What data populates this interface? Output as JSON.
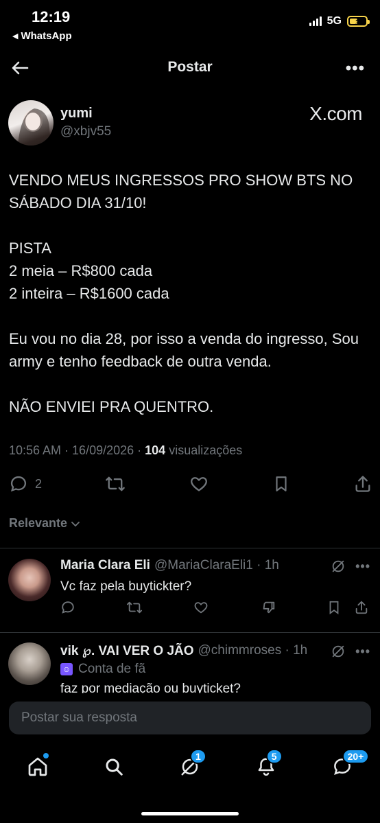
{
  "status": {
    "time": "12:19",
    "back_app": "WhatsApp",
    "network": "5G"
  },
  "header": {
    "title": "Postar"
  },
  "post": {
    "author_name": "yumi",
    "author_handle": "@xbjv55",
    "watermark": "X.com",
    "lines": [
      "VENDO MEUS INGRESSOS PRO SHOW BTS NO SÁBADO DIA 31/10!",
      "",
      "PISTA",
      "2 meia – R$800 cada",
      "2 inteira – R$1600 cada",
      "",
      "Eu vou no dia 28, por isso a venda do ingresso, Sou army e tenho feedback de outra venda.",
      "",
      "NÃO ENVIEI PRA QUENTRO."
    ],
    "timestamp": "10:56 AM · 16/09/2026 · ",
    "views_count": "104",
    "views_label": " visualizações",
    "reply_count": "2"
  },
  "sort_label": "Relevante",
  "replies": [
    {
      "name": "Maria Clara Eli",
      "handle": "@MariaClaraEli1 · 1h",
      "text": "Vc faz pela buytickter?"
    },
    {
      "name": "vik ℘. VAI VER O JÃO",
      "handle": "@chimmroses · 1h",
      "fan_label": "Conta de fã",
      "text": "faz por mediação ou buyticket?"
    }
  ],
  "reply_placeholder": "Postar sua resposta",
  "tabbar": {
    "spaces_badge": "1",
    "notifications_badge": "5",
    "messages_badge": "20+"
  }
}
